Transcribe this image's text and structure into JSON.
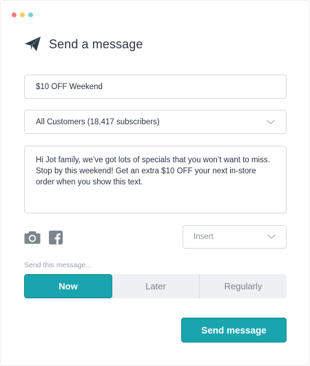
{
  "colors": {
    "accent": "#1aa5ae",
    "text": "#2c3440",
    "muted": "#9aa0a8",
    "border": "#d4d8de"
  },
  "header": {
    "icon": "paper-plane-icon",
    "title": "Send a message"
  },
  "form": {
    "subject_value": "$10 OFF Weekend",
    "audience_value": "All Customers (18,417 subscribers)",
    "message_body": "Hi Jot family, we’ve got lots of specials that you won’t want to miss. Stop by this weekend! Get an extra $10 OFF your next in-store order when you show this text.",
    "attachments": [
      "camera-icon",
      "facebook-icon"
    ],
    "insert_label": "Insert"
  },
  "schedule": {
    "label": "Send this message...",
    "options": [
      "Now",
      "Later",
      "Regularly"
    ],
    "selected": "Now"
  },
  "actions": {
    "send_label": "Send message"
  }
}
